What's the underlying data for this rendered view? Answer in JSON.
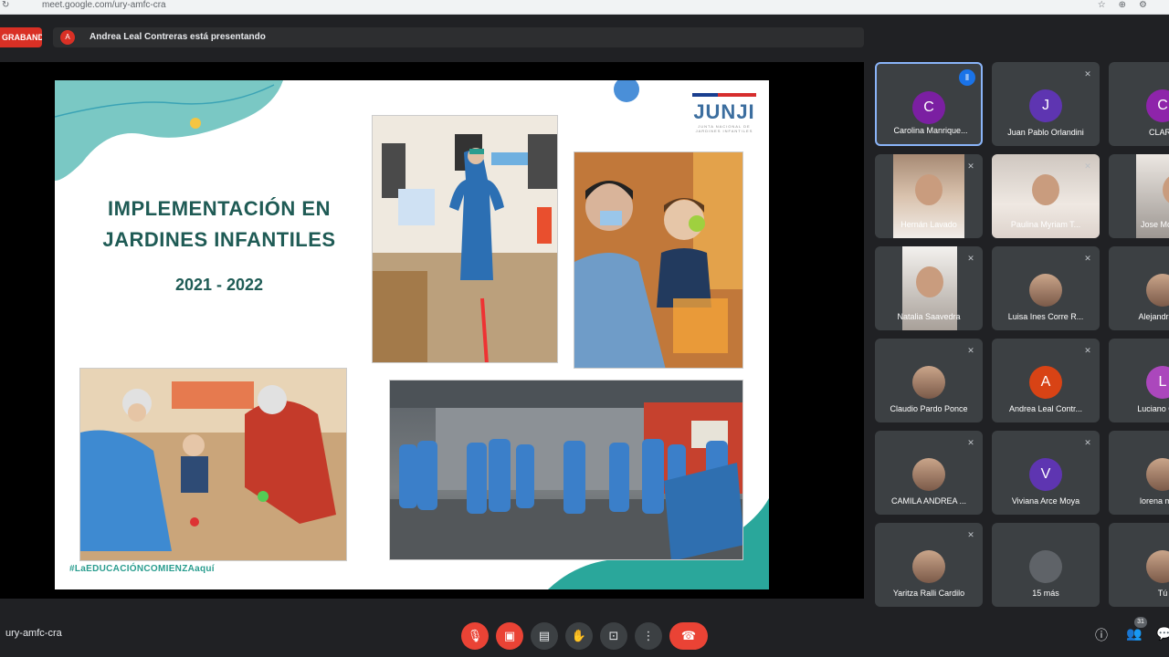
{
  "browser": {
    "url": "meet.google.com/ury-amfc-cra",
    "nav_icon": "reload-icon"
  },
  "topbar": {
    "recording_label": "GRABANDO",
    "presenter_initial": "A",
    "presenter_text": "Andrea Leal Contreras está presentando"
  },
  "slide": {
    "logo_name": "JUNJI",
    "logo_sub": "JUNTA NACIONAL DE JARDINES INFANTILES",
    "title_line1": "IMPLEMENTACIÓN EN",
    "title_line2": "JARDINES INFANTILES",
    "years": "2021 - 2022",
    "hashtag": "#LaEDUCACIÓNCOMIENZAaquí"
  },
  "participants": [
    {
      "name": "Carolina Manrique...",
      "initial": "C",
      "color": "#7b1fa2",
      "type": "avatar",
      "status": "speaking"
    },
    {
      "name": "Juan Pablo Orlandini",
      "initial": "J",
      "color": "#5e35b1",
      "type": "avatar",
      "status": "muted"
    },
    {
      "name": "CLARA",
      "initial": "C",
      "color": "#8e24aa",
      "type": "avatar",
      "status": "muted"
    },
    {
      "name": "Hernán Lavado",
      "type": "video",
      "status": "muted"
    },
    {
      "name": "Paulina Myriam T...",
      "type": "video2",
      "status": "muted"
    },
    {
      "name": "Jose Molina",
      "type": "video4",
      "status": "muted"
    },
    {
      "name": "Natalia Saavedra",
      "type": "video3",
      "status": "muted"
    },
    {
      "name": "Luisa Ines Corre R...",
      "type": "photo",
      "status": "muted"
    },
    {
      "name": "Alejandra L...",
      "type": "photo",
      "status": "muted"
    },
    {
      "name": "Claudio Pardo Ponce",
      "type": "photo",
      "status": "muted"
    },
    {
      "name": "Andrea Leal Contr...",
      "initial": "A",
      "color": "#d84315",
      "type": "avatar",
      "status": "muted"
    },
    {
      "name": "Luciano Car...",
      "initial": "L",
      "color": "#ab47bc",
      "type": "avatar",
      "status": "muted"
    },
    {
      "name": "CAMILA ANDREA ...",
      "type": "photo",
      "status": "muted"
    },
    {
      "name": "Viviana Arce Moya",
      "initial": "V",
      "color": "#5e35b1",
      "type": "avatar",
      "status": "muted"
    },
    {
      "name": "lorena mar...",
      "type": "photo",
      "status": "muted"
    },
    {
      "name": "Yaritza Ralli Cardilo",
      "type": "photo",
      "status": "muted"
    },
    {
      "name": "15 más",
      "initial": "15",
      "color": "#5f6368",
      "type": "more",
      "status": "none"
    },
    {
      "name": "Tú",
      "type": "photo",
      "status": "none"
    }
  ],
  "bottom": {
    "meeting_code": "ury-amfc-cra",
    "people_count": "31"
  },
  "colors": {
    "accent_red": "#ea4335",
    "accent_blue": "#1a73e8",
    "tile_bg": "#3c4043"
  }
}
